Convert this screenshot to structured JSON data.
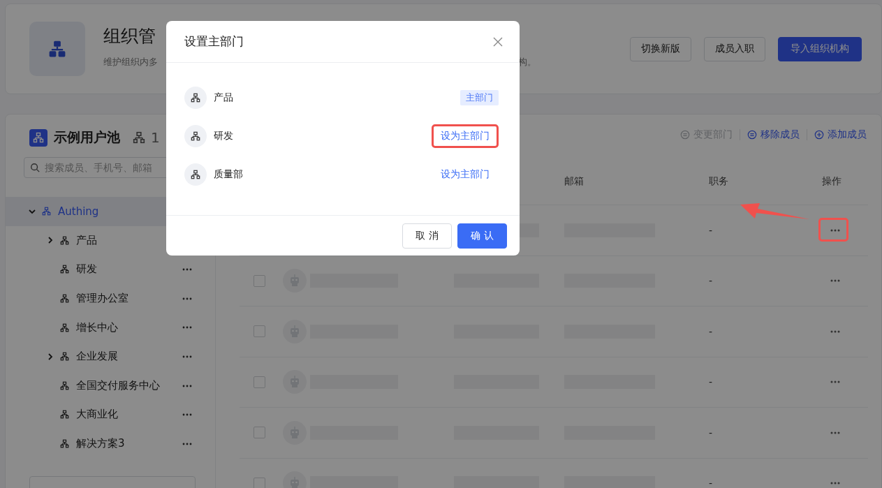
{
  "header": {
    "title": "组织管",
    "subtitle_start": "维护组织内多",
    "subtitle_end": "构。",
    "buttons": [
      {
        "label": "切换新版",
        "kind": "default"
      },
      {
        "label": "成员入职",
        "kind": "default"
      },
      {
        "label": "导入组织机构",
        "kind": "primary"
      }
    ]
  },
  "sidebar": {
    "title": "示例用户池",
    "count": "1",
    "search": {
      "placeholder": "搜索成员、手机号、邮箱"
    },
    "tree": [
      {
        "label": "Authing",
        "selected": true,
        "expanded": true,
        "children": [
          {
            "label": "产品",
            "selected": false,
            "expanded": false
          },
          {
            "label": "研发",
            "selected": false
          },
          {
            "label": "管理办公室",
            "selected": false
          },
          {
            "label": "增长中心",
            "selected": false
          },
          {
            "label": "企业发展",
            "selected": false,
            "expanded": false
          },
          {
            "label": "全国交付服务中心",
            "selected": false
          },
          {
            "label": "大商业化",
            "selected": false
          },
          {
            "label": "解决方案3",
            "selected": false
          }
        ]
      }
    ]
  },
  "toolbar": [
    {
      "label": "变更部门",
      "kind": "change",
      "disabled": true
    },
    {
      "label": "移除成员",
      "kind": "remove",
      "disabled": false
    },
    {
      "label": "添加成员",
      "kind": "add",
      "disabled": false
    }
  ],
  "table": {
    "columns": [
      "邮箱",
      "职务",
      "操作"
    ],
    "rows": [
      {
        "title": "-",
        "highlighted": true
      },
      {
        "title": "-",
        "checked": false,
        "highlighted": false
      },
      {
        "title": "-",
        "checked": false,
        "highlighted": false
      },
      {
        "title": "-",
        "checked": false,
        "highlighted": false
      },
      {
        "title": "-",
        "checked": false,
        "highlighted": false
      },
      {
        "title": "-",
        "checked": false,
        "highlighted": false
      }
    ]
  },
  "modal": {
    "title": "设置主部门",
    "departments": [
      {
        "name": "产品",
        "primary": true,
        "label": "主部门",
        "highlighted": false
      },
      {
        "name": "研发",
        "primary": false,
        "label": "设为主部门",
        "highlighted": true
      },
      {
        "name": "质量部",
        "primary": false,
        "label": "设为主部门",
        "highlighted": false
      }
    ],
    "buttons": [
      {
        "label": "取 消",
        "kind": "default"
      },
      {
        "label": "确 认",
        "kind": "primary"
      }
    ]
  }
}
